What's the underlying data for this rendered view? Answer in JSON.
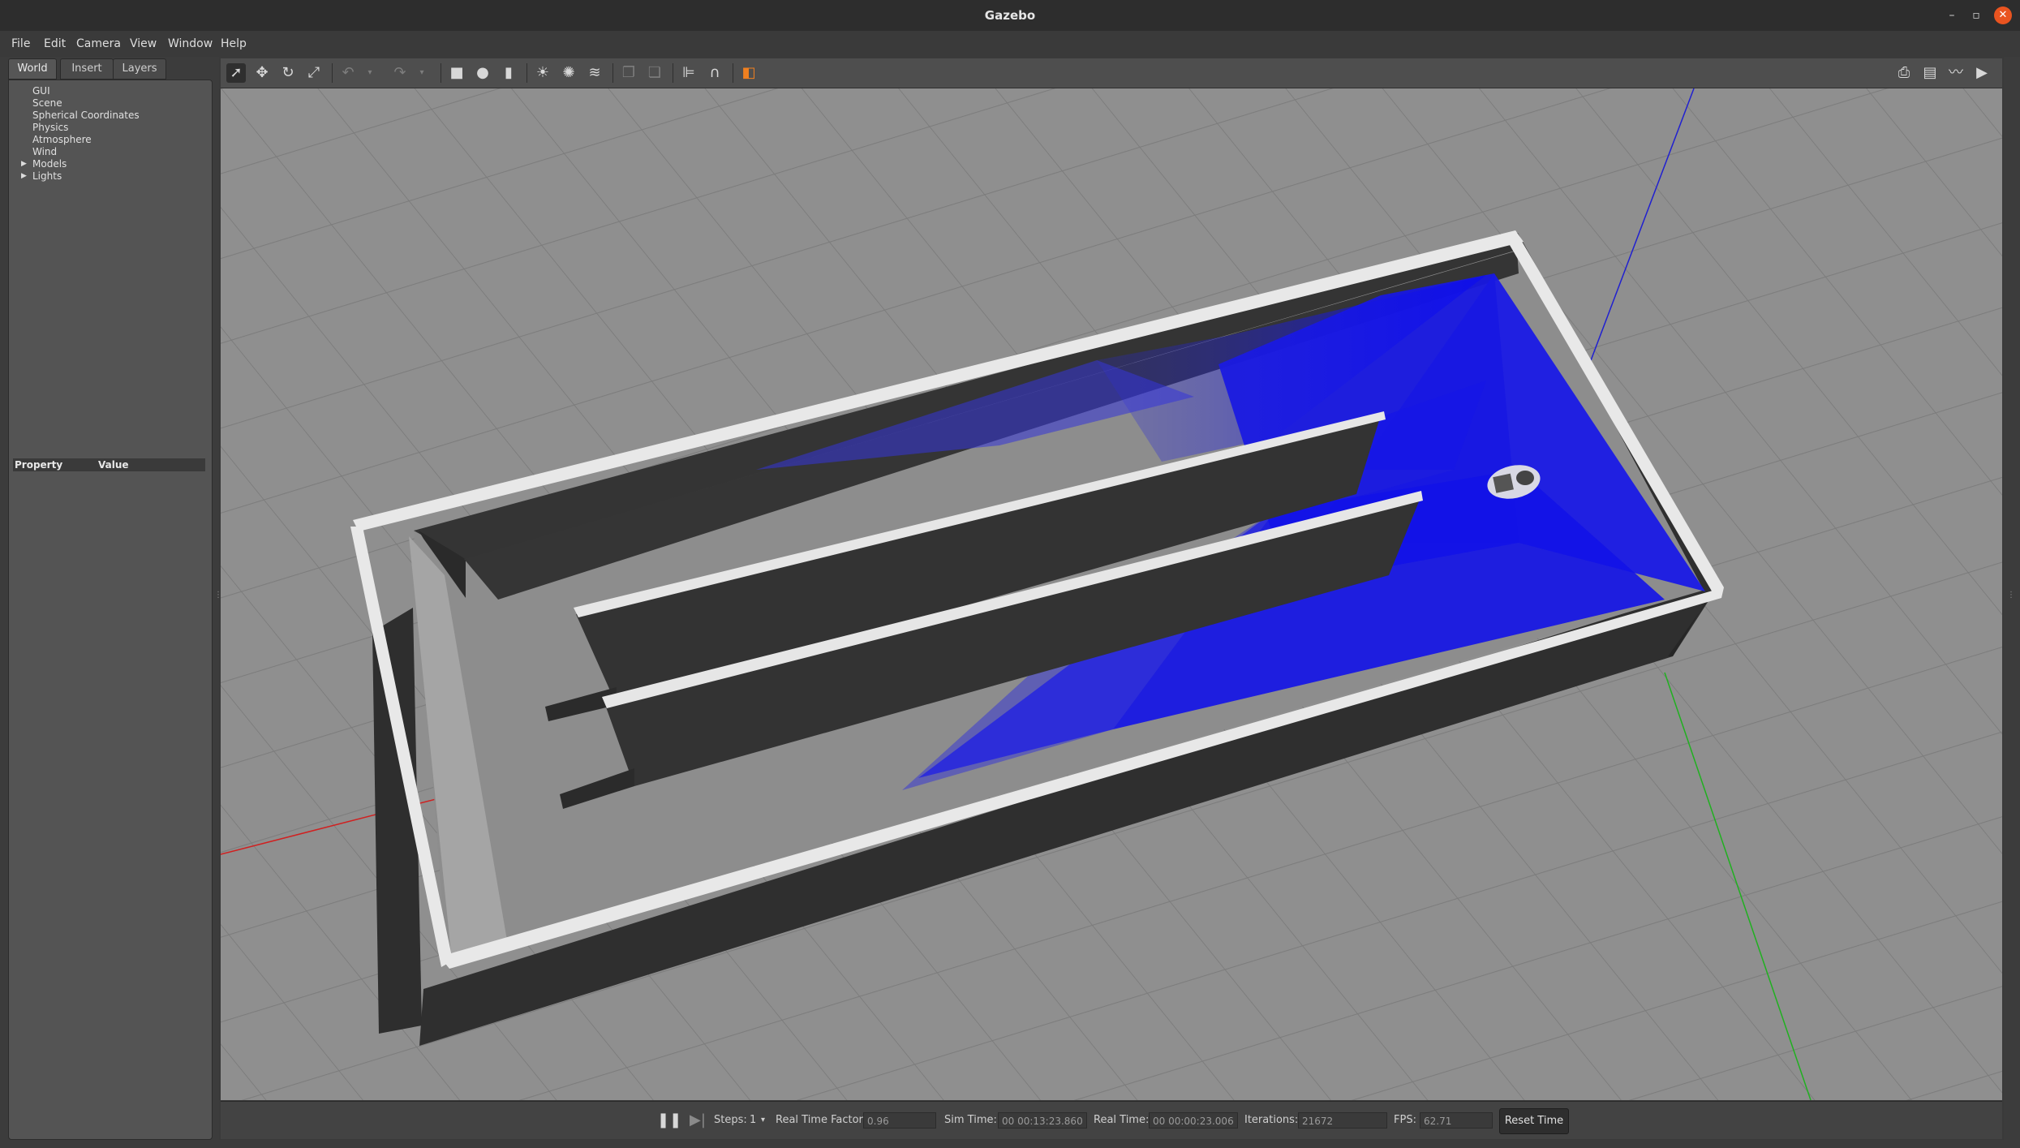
{
  "window": {
    "title": "Gazebo",
    "controls": {
      "minimize": "–",
      "restore": "▫",
      "close": "✕"
    }
  },
  "menu": {
    "items": [
      "File",
      "Edit",
      "Camera",
      "View",
      "Window",
      "Help"
    ]
  },
  "left_panel": {
    "tabs": [
      "World",
      "Insert",
      "Layers"
    ],
    "active_tab": "World",
    "tree": [
      {
        "label": "GUI",
        "expandable": false
      },
      {
        "label": "Scene",
        "expandable": false
      },
      {
        "label": "Spherical Coordinates",
        "expandable": false
      },
      {
        "label": "Physics",
        "expandable": false
      },
      {
        "label": "Atmosphere",
        "expandable": false
      },
      {
        "label": "Wind",
        "expandable": false
      },
      {
        "label": "Models",
        "expandable": true
      },
      {
        "label": "Lights",
        "expandable": true
      }
    ],
    "property_table": {
      "col_property": "Property",
      "col_value": "Value"
    }
  },
  "toolbar": {
    "left_icons": [
      "select-mode-icon",
      "translate-mode-icon",
      "rotate-mode-icon",
      "scale-mode-icon",
      "undo-icon",
      "undo-history-icon",
      "redo-icon",
      "redo-history-icon",
      "box-shape-icon",
      "sphere-shape-icon",
      "cylinder-shape-icon",
      "point-light-icon",
      "spot-light-icon",
      "directional-light-icon",
      "copy-icon",
      "paste-icon",
      "align-icon",
      "snap-icon",
      "view-angle-icon"
    ],
    "right_icons": [
      "screenshot-icon",
      "log-data-icon",
      "plot-icon",
      "video-record-icon"
    ],
    "active_tool": "select-mode-icon"
  },
  "bottom_bar": {
    "pause_icon": "pause-icon",
    "step_icon": "step-icon",
    "steps_label": "Steps:",
    "steps_value": "1",
    "rtf_label": "Real Time Factor:",
    "rtf_value": "0.96",
    "sim_time_label": "Sim Time:",
    "sim_time_value": "00 00:13:23.860",
    "real_time_label": "Real Time:",
    "real_time_value": "00 00:00:23.006",
    "iterations_label": "Iterations:",
    "iterations_value": "21672",
    "fps_label": "FPS:",
    "fps_value": "62.71",
    "reset_button": "Reset Time"
  },
  "scene": {
    "background_color": "#8f8f8f",
    "wall_top_color": "#e6e6e6",
    "wall_side_color": "#2f2f2f",
    "laser_color": "#1010e0",
    "axis_x_color": "#d02020",
    "axis_y_color": "#20b020",
    "axis_z_color": "#2020d0"
  }
}
